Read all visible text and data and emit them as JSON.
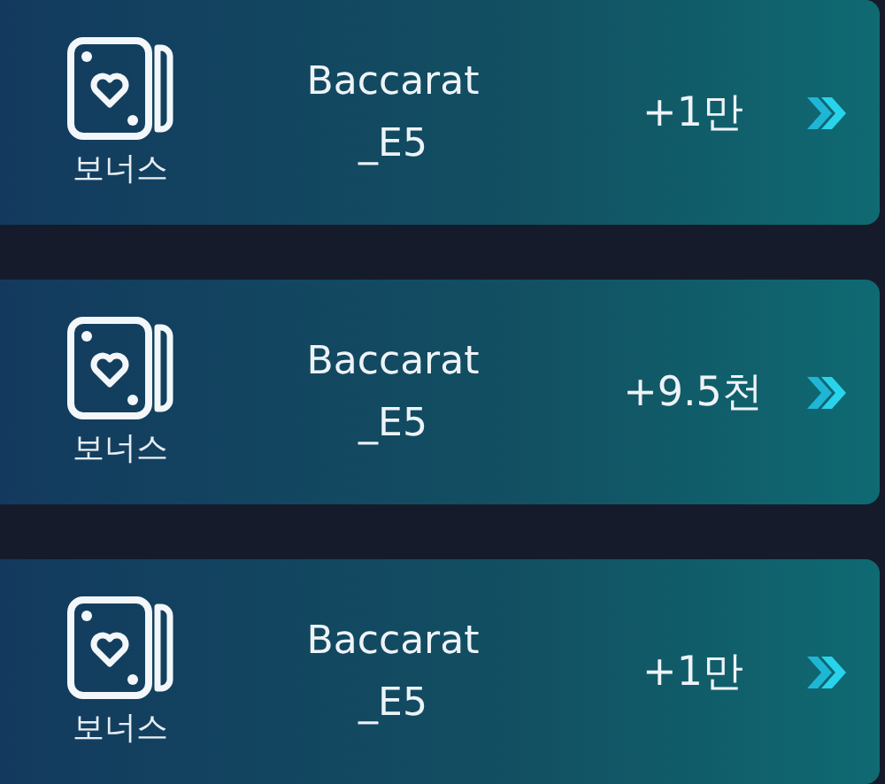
{
  "items": [
    {
      "badge": "보너스",
      "game": "Baccarat",
      "game_code": "_E5",
      "reward": "+1만"
    },
    {
      "badge": "보너스",
      "game": "Baccarat",
      "game_code": "_E5",
      "reward": "+9.5천"
    },
    {
      "badge": "보너스",
      "game": "Baccarat",
      "game_code": "_E5",
      "reward": "+1만"
    }
  ]
}
